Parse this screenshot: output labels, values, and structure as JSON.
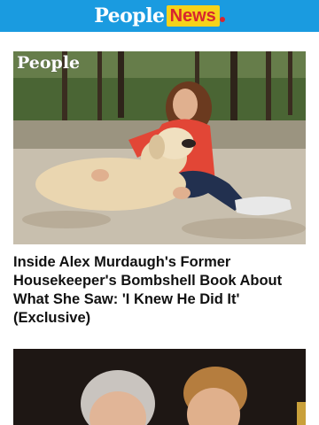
{
  "header": {
    "brand_people": "People",
    "brand_news": "News",
    "accent_color": "#1a9be0",
    "news_bg": "#f5d21a",
    "news_text": "#d7262f"
  },
  "articles": [
    {
      "photo_logo": "People",
      "headline": "Inside Alex Murdaugh's Former Housekeeper's Bombshell Book About What She Saw: 'I Knew He Did It' (Exclusive)"
    },
    {
      "photo_logo": "",
      "headline": ""
    }
  ]
}
